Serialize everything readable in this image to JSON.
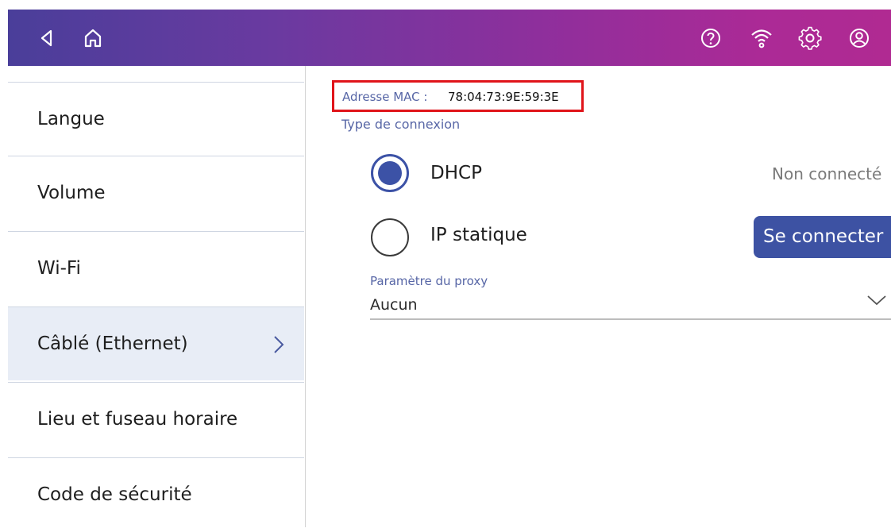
{
  "header": {
    "icons": [
      "back-icon",
      "home-icon",
      "help-icon",
      "wifi-icon",
      "settings-icon",
      "account-icon"
    ]
  },
  "sidebar": {
    "items": [
      {
        "label": "Langue"
      },
      {
        "label": "Volume"
      },
      {
        "label": "Wi-Fi"
      },
      {
        "label": "Câblé (Ethernet)"
      },
      {
        "label": "Lieu et fuseau horaire"
      },
      {
        "label": "Code de sécurité"
      }
    ],
    "active_index": 3
  },
  "main": {
    "mac_label": "Adresse MAC :",
    "mac_value": "78:04:73:9E:59:3E",
    "connection_type_label": "Type de connexion",
    "options": [
      {
        "label": "DHCP",
        "selected": true
      },
      {
        "label": "IP statique",
        "selected": false
      }
    ],
    "status": "Non connecté",
    "connect_button": "Se connecter",
    "proxy": {
      "label": "Paramètre du proxy",
      "value": "Aucun"
    }
  },
  "colors": {
    "accent": "#3d52a3",
    "highlight_border": "#e0141a",
    "header_gradient_start": "#4a3e9a",
    "header_gradient_end": "#b02a92"
  }
}
